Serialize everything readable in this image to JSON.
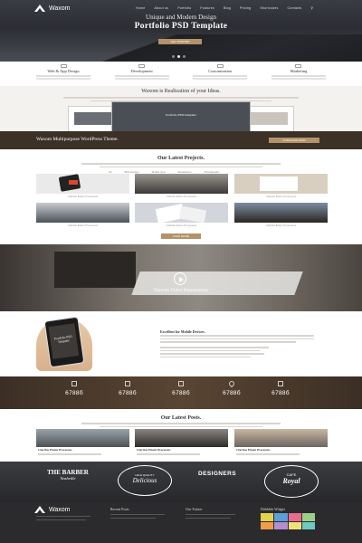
{
  "brand": {
    "name": "Waxom"
  },
  "nav": [
    "Home",
    "About us",
    "Portfolio",
    "Features",
    "Blog",
    "Pricing",
    "Shortcodes",
    "Contacts"
  ],
  "hero": {
    "subtitle": "Unique and Modern Design",
    "title": "Portfolio PSD Template",
    "button": "GET STARTED",
    "slides": 3,
    "active_slide": 2
  },
  "features": [
    {
      "title": "Web & App Design",
      "icon": "monitor-icon"
    },
    {
      "title": "Development",
      "icon": "code-icon"
    },
    {
      "title": "Customization",
      "icon": "gear-icon"
    },
    {
      "title": "Marketing",
      "icon": "chart-icon"
    }
  ],
  "realization": {
    "title": "Waxom is Realization of your Ideas.",
    "screen_title": "Portfolio PSD Template"
  },
  "band": {
    "text": "Waxom Multipurpose WordPress Theme.",
    "button": "PURCHASE NOW"
  },
  "projects": {
    "title": "Our Latest Projects.",
    "filters": [
      "All",
      "Web Design",
      "Mobile App",
      "Illustrations",
      "Photography"
    ],
    "items": [
      {
        "caption": "Claritas Etiam Processus",
        "sub": "Photography, Nature"
      },
      {
        "caption": "Claritas Etiam Processus",
        "sub": "Photography, Nature"
      },
      {
        "caption": "Claritas Etiam Processus",
        "sub": "Photography, Nature"
      },
      {
        "caption": "Claritas Etiam Processus",
        "sub": "Photography, Nature"
      },
      {
        "caption": "Claritas Etiam Processus",
        "sub": "Photography, Nature"
      },
      {
        "caption": "Claritas Etiam Processus",
        "sub": "Photography, Nature"
      }
    ],
    "more_button": "LOAD MORE"
  },
  "video": {
    "title": "Waxom Video Presentation"
  },
  "mobile": {
    "title": "Excellent for Mobile Devices.",
    "phone_text": "Portfolio PSD Template"
  },
  "counters": [
    {
      "value": "6788б",
      "icon": "bulb-icon"
    },
    {
      "value": "6788б",
      "icon": "coffee-icon"
    },
    {
      "value": "6788б",
      "icon": "cup-icon"
    },
    {
      "value": "6788б",
      "icon": "heart-icon"
    },
    {
      "value": "6788б",
      "icon": "chat-icon"
    }
  ],
  "blog": {
    "title": "Our Latest Posts.",
    "posts": [
      {
        "title": "Claritas Etiam Processus"
      },
      {
        "title": "Claritas Etiam Processus"
      },
      {
        "title": "Claritas Etiam Processus"
      }
    ]
  },
  "clients": [
    {
      "line1": "THE BARBER",
      "line2": "Nashville"
    },
    {
      "line1": "HIGH QUALITY",
      "line2": "Delicious"
    },
    {
      "line1": "DESIGNERS",
      "line2": ""
    },
    {
      "line1": "CAFE",
      "line2": "Royal"
    }
  ],
  "footer": {
    "brand": "Waxom",
    "recent_posts": "Recent Posts",
    "twitter": "Our Twitter",
    "dribbble": "Dribbble Widget"
  }
}
